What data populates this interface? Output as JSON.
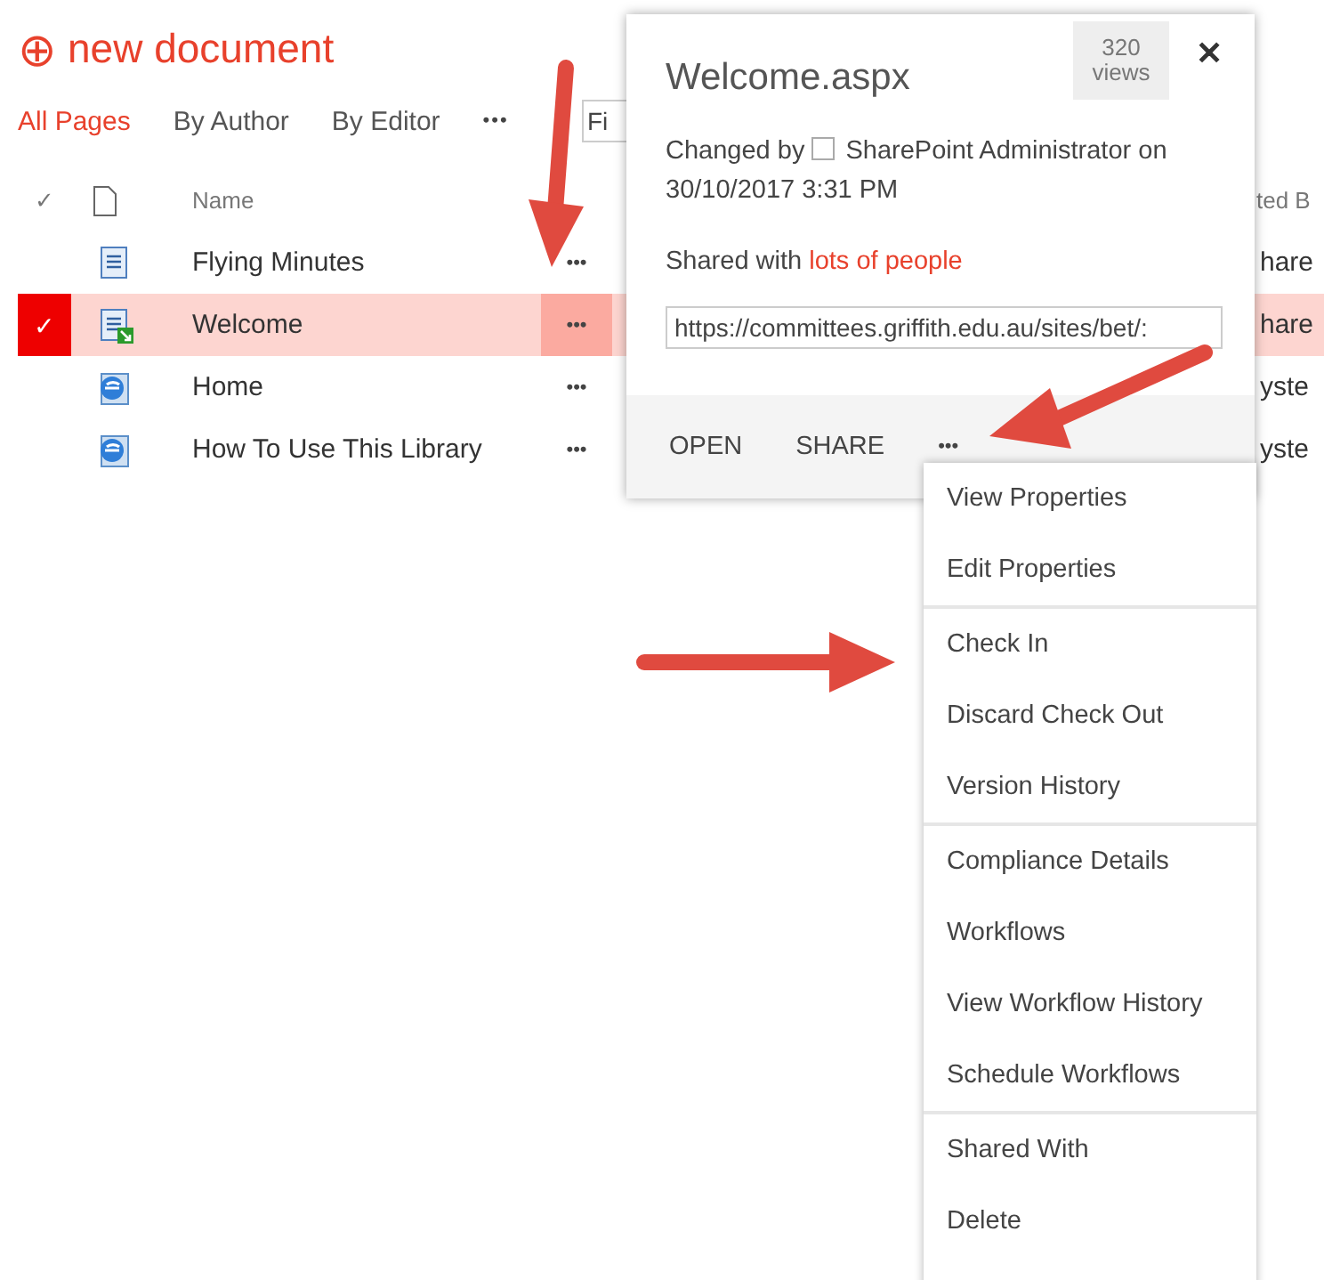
{
  "new_document": {
    "icon": "⊕",
    "label": "new document"
  },
  "views": [
    {
      "label": "All Pages",
      "selected": true
    },
    {
      "label": "By Author",
      "selected": false
    },
    {
      "label": "By Editor",
      "selected": false
    }
  ],
  "views_more": "•••",
  "search": {
    "placeholder": "Fi"
  },
  "table": {
    "columns": [
      {
        "label": "✓"
      },
      {
        "label": "Name"
      },
      {
        "label": "ted B"
      }
    ],
    "rows": [
      {
        "name": "Flying Minutes",
        "kind": "page",
        "selected": false,
        "column_3": "hare"
      },
      {
        "name": "Welcome",
        "kind": "checked-out",
        "selected": true,
        "column_3": "hare"
      },
      {
        "name": "Home",
        "kind": "web",
        "selected": false,
        "column_3": "yste"
      },
      {
        "name": "How To Use This Library",
        "kind": "web",
        "selected": false,
        "column_3": "yste"
      }
    ]
  },
  "row_menu": "•••",
  "callout": {
    "title": "Welcome.aspx",
    "views_count": "320",
    "views_label": "views",
    "close": "✕",
    "changed_by": "Changed by",
    "editor": "SharePoint Administrator",
    "on": "on",
    "date": "30/10/2017 3:31 PM",
    "shared_prefix": "Shared with",
    "shared_link": "lots of people",
    "url": "https://committees.griffith.edu.au/sites/bet/:",
    "actions": [
      "OPEN",
      "SHARE"
    ],
    "more": "•••"
  },
  "menu": {
    "groups": [
      [
        "View Properties",
        "Edit Properties"
      ],
      [
        "Check In",
        "Discard Check Out",
        "Version History"
      ],
      [
        "Compliance Details",
        "Workflows",
        "View Workflow History",
        "Schedule Workflows"
      ],
      [
        "Shared With",
        "Delete"
      ]
    ]
  }
}
